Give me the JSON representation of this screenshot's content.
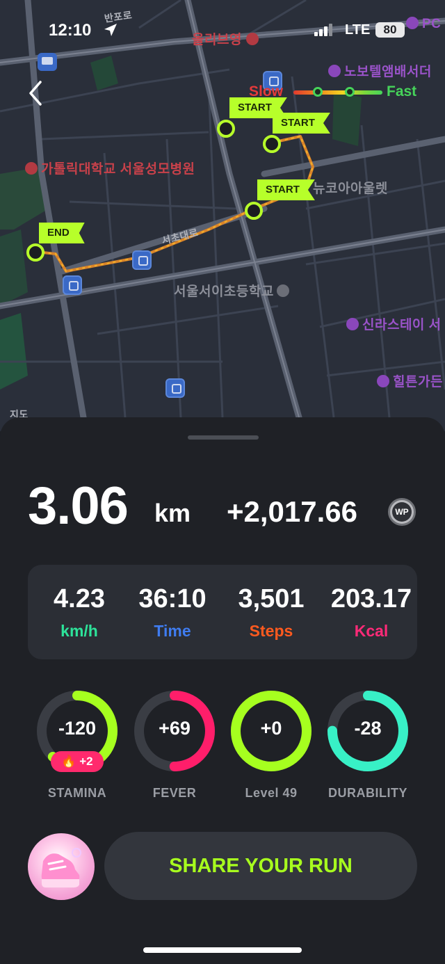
{
  "status_bar": {
    "time": "12:10",
    "network": "LTE",
    "battery": "80"
  },
  "map": {
    "legend": {
      "slow_label": "Slow",
      "fast_label": "Fast"
    },
    "labels": [
      {
        "text": "올리브영"
      },
      {
        "text": "노보텔앰배서더"
      },
      {
        "text": "가톨릭대학교 서울성모병원"
      },
      {
        "text": "서울서이초등학교"
      },
      {
        "text": "신라스테이 서"
      },
      {
        "text": "힐튼가든"
      },
      {
        "text": "뉴코아아울렛"
      },
      {
        "text": "반포로"
      },
      {
        "text": "서초대로"
      },
      {
        "text": "지도"
      },
      {
        "text": "PC"
      }
    ],
    "flags": {
      "start_label": "START",
      "end_label": "END"
    }
  },
  "summary": {
    "distance_value": "3.06",
    "distance_unit": "km",
    "wp_value": "+2,017.66",
    "wp_icon_label": "WP"
  },
  "stats": [
    {
      "value": "4.23",
      "label": "km/h",
      "color": "#2de39a"
    },
    {
      "value": "36:10",
      "label": "Time",
      "color": "#3f7cf0"
    },
    {
      "value": "3,501",
      "label": "Steps",
      "color": "#ff5a1f"
    },
    {
      "value": "203.17",
      "label": "Kcal",
      "color": "#ff2a78"
    }
  ],
  "rings": [
    {
      "value": "-120",
      "label": "STAMINA",
      "fill": 0.62,
      "color": "#a6ff1f",
      "badge": "🔥 +2"
    },
    {
      "value": "+69",
      "label": "FEVER",
      "fill": 0.5,
      "color": "#ff1e6a"
    },
    {
      "value": "+0",
      "label": "Level 49",
      "fill": 1.0,
      "color": "#a6ff1f"
    },
    {
      "value": "-28",
      "label": "DURABILITY",
      "fill": 0.75,
      "color": "#38f0c6"
    }
  ],
  "share_button_label": "SHARE YOUR RUN"
}
